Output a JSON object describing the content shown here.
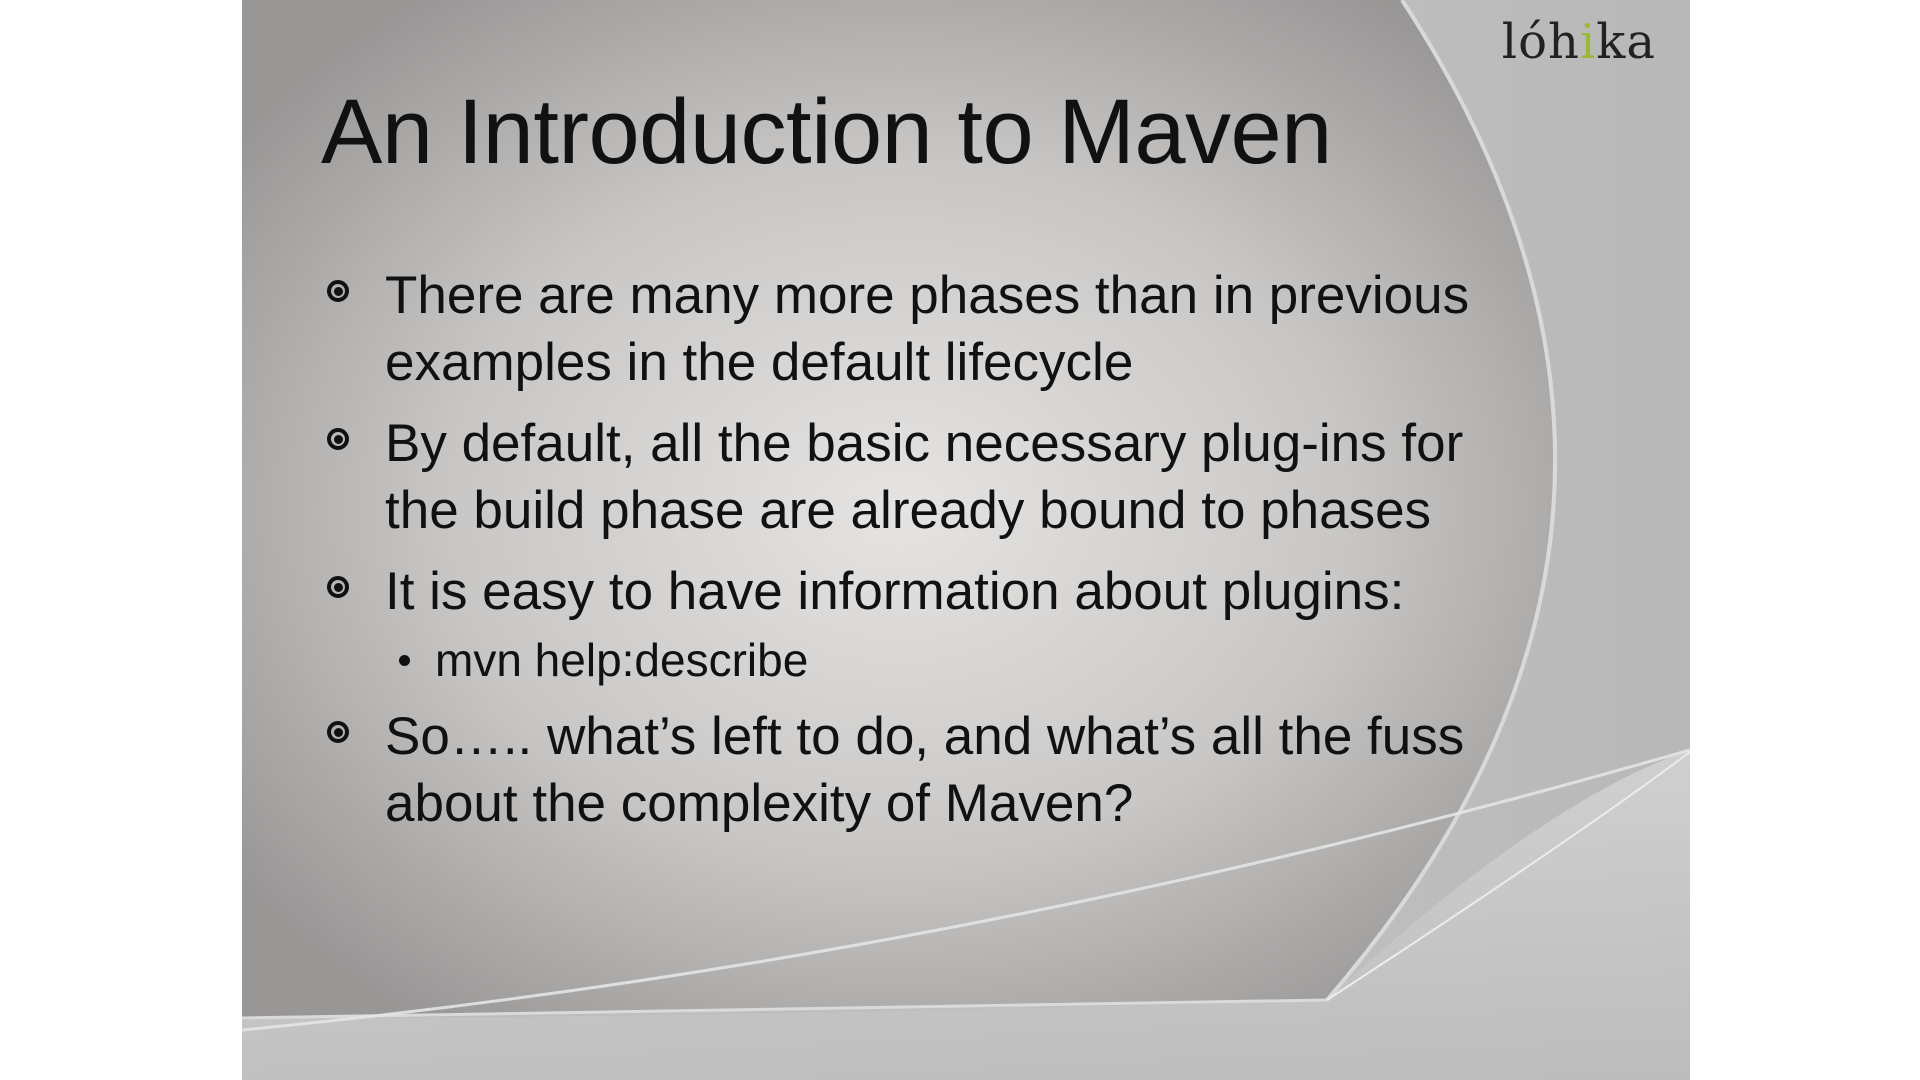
{
  "logo": {
    "before": "lóh",
    "accent_letter": "i",
    "after": "ka",
    "accent_color": "#9bb83a"
  },
  "slide": {
    "title": "An Introduction to Maven",
    "bullets": [
      {
        "text": "There are many more phases than in previous examples in the default lifecycle"
      },
      {
        "text": "By default, all the basic necessary plug-ins for the build phase are already bound to phases"
      },
      {
        "text": "It is easy to have information about plugins:",
        "sub_items": [
          "mvn help:describe"
        ]
      },
      {
        "text": "So….. what’s left to do, and what’s all the fuss about the complexity of Maven?"
      }
    ]
  },
  "colors": {
    "background_light": "#e6e4e2",
    "background_dark": "#9b9998",
    "text": "#111111"
  }
}
